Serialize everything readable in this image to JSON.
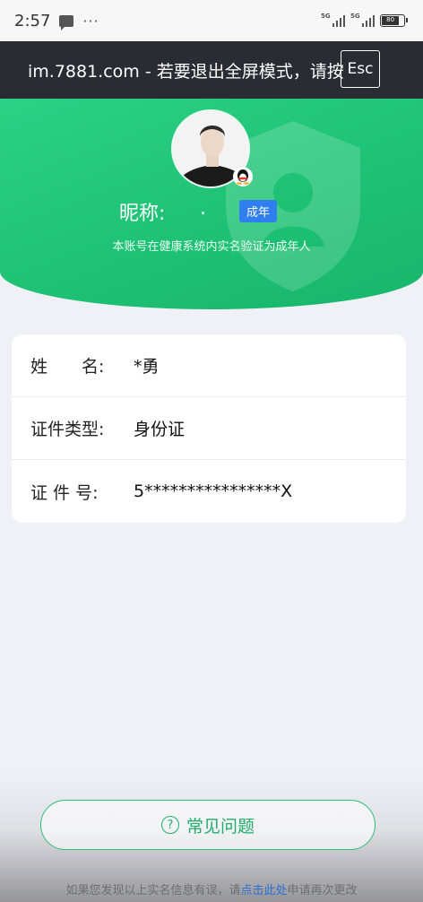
{
  "status_bar": {
    "time": "2:57",
    "dots": "···",
    "signal1_tag": "5G",
    "signal2_tag": "5G",
    "battery": "80"
  },
  "banner": {
    "text": "im.7881.com - 若要退出全屏模式，请按",
    "esc_label": "Esc"
  },
  "profile": {
    "nickname_label": "昵称:",
    "nickname_value": ".",
    "adult_badge": "成年",
    "verification_note": "本账号在健康系统内实名验证为成年人"
  },
  "info": {
    "rows": [
      {
        "label": "姓　　名:",
        "value": "*勇"
      },
      {
        "label": "证件类型:",
        "value": "身份证"
      },
      {
        "label": "证 件 号:",
        "value": "5****************X"
      }
    ]
  },
  "faq": {
    "icon": "?",
    "label": "常见问题"
  },
  "footer": {
    "prefix": "如果您发现以上实名信息有误，请",
    "link": "点击此处",
    "suffix": "申请再次更改"
  },
  "colors": {
    "green": "#1fc274",
    "badge_blue": "#2f7ff0",
    "banner_bg": "#292c33"
  }
}
